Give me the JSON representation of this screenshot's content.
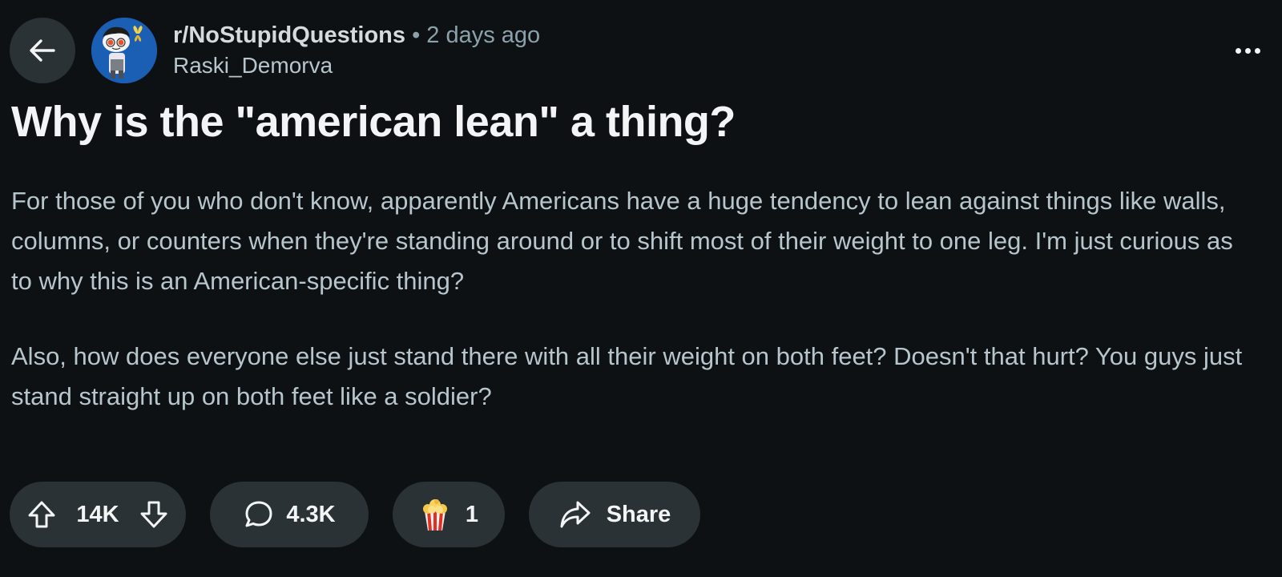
{
  "header": {
    "subreddit": "r/NoStupidQuestions",
    "separator": "•",
    "time": "2 days ago",
    "username": "Raski_Demorva",
    "back_icon": "arrow-left-icon",
    "more_icon": "more-horizontal-icon"
  },
  "post": {
    "title": "Why is the \"american lean\" a thing?",
    "paragraphs": [
      "For those of you who don't know, apparently Americans have a huge tendency to lean against things like walls, columns, or counters when they're standing around or to shift most of their weight to one leg. I'm just curious as to why this is an American-specific thing?",
      "Also, how does everyone else just stand there with all their weight on both feet? Doesn't that hurt? You guys just stand straight up on both feet like a soldier?"
    ]
  },
  "actions": {
    "vote_count": "14K",
    "comment_count": "4.3K",
    "award_count": "1",
    "share_label": "Share"
  },
  "colors": {
    "background": "#0e1113",
    "pill": "#2a3236",
    "text_primary": "#f2f4f5",
    "text_body": "#b7c5cc",
    "text_meta": "#8ba2ad",
    "avatar_bg": "#1a5fb4"
  }
}
